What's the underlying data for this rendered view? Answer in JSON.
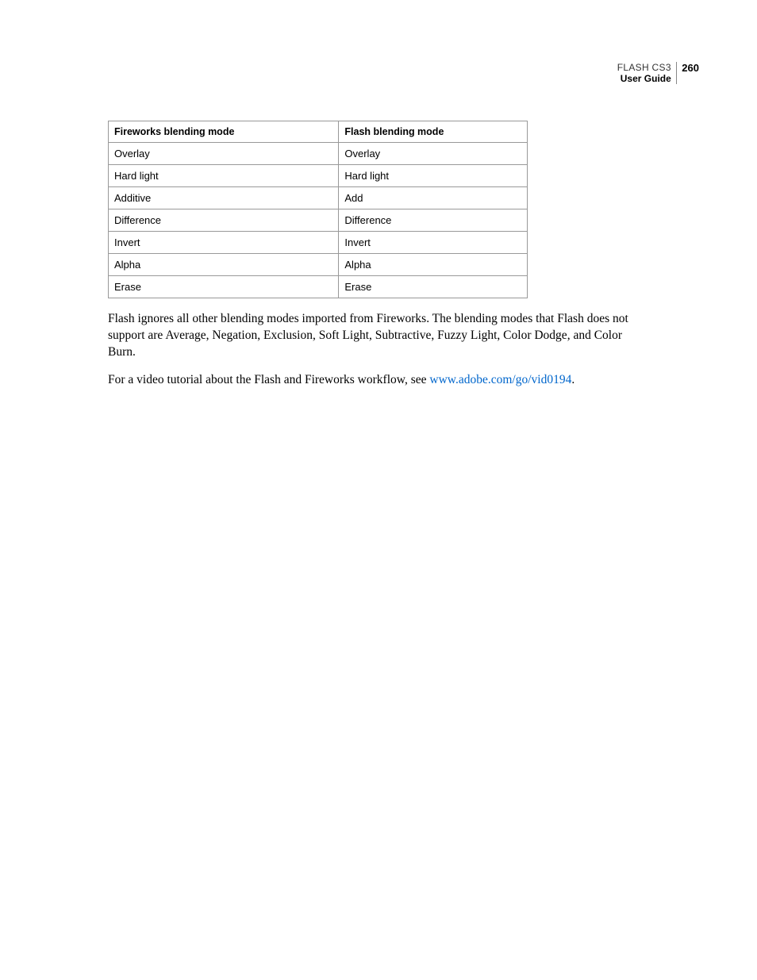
{
  "header": {
    "product": "FLASH CS3",
    "guide": "User Guide",
    "page_number": "260"
  },
  "table": {
    "headers": {
      "col1": "Fireworks blending mode",
      "col2": "Flash blending mode"
    },
    "rows": [
      {
        "col1": "Overlay",
        "col2": "Overlay"
      },
      {
        "col1": "Hard light",
        "col2": "Hard light"
      },
      {
        "col1": "Additive",
        "col2": "Add"
      },
      {
        "col1": "Difference",
        "col2": "Difference"
      },
      {
        "col1": "Invert",
        "col2": "Invert"
      },
      {
        "col1": "Alpha",
        "col2": "Alpha"
      },
      {
        "col1": "Erase",
        "col2": "Erase"
      }
    ]
  },
  "paragraphs": {
    "p1": "Flash ignores all other blending modes imported from Fireworks. The blending modes that Flash does not support are Average, Negation, Exclusion, Soft Light, Subtractive, Fuzzy Light, Color Dodge, and Color Burn.",
    "p2_prefix": "For a video tutorial about the Flash and Fireworks workflow, see ",
    "p2_link": "www.adobe.com/go/vid0194",
    "p2_suffix": "."
  }
}
